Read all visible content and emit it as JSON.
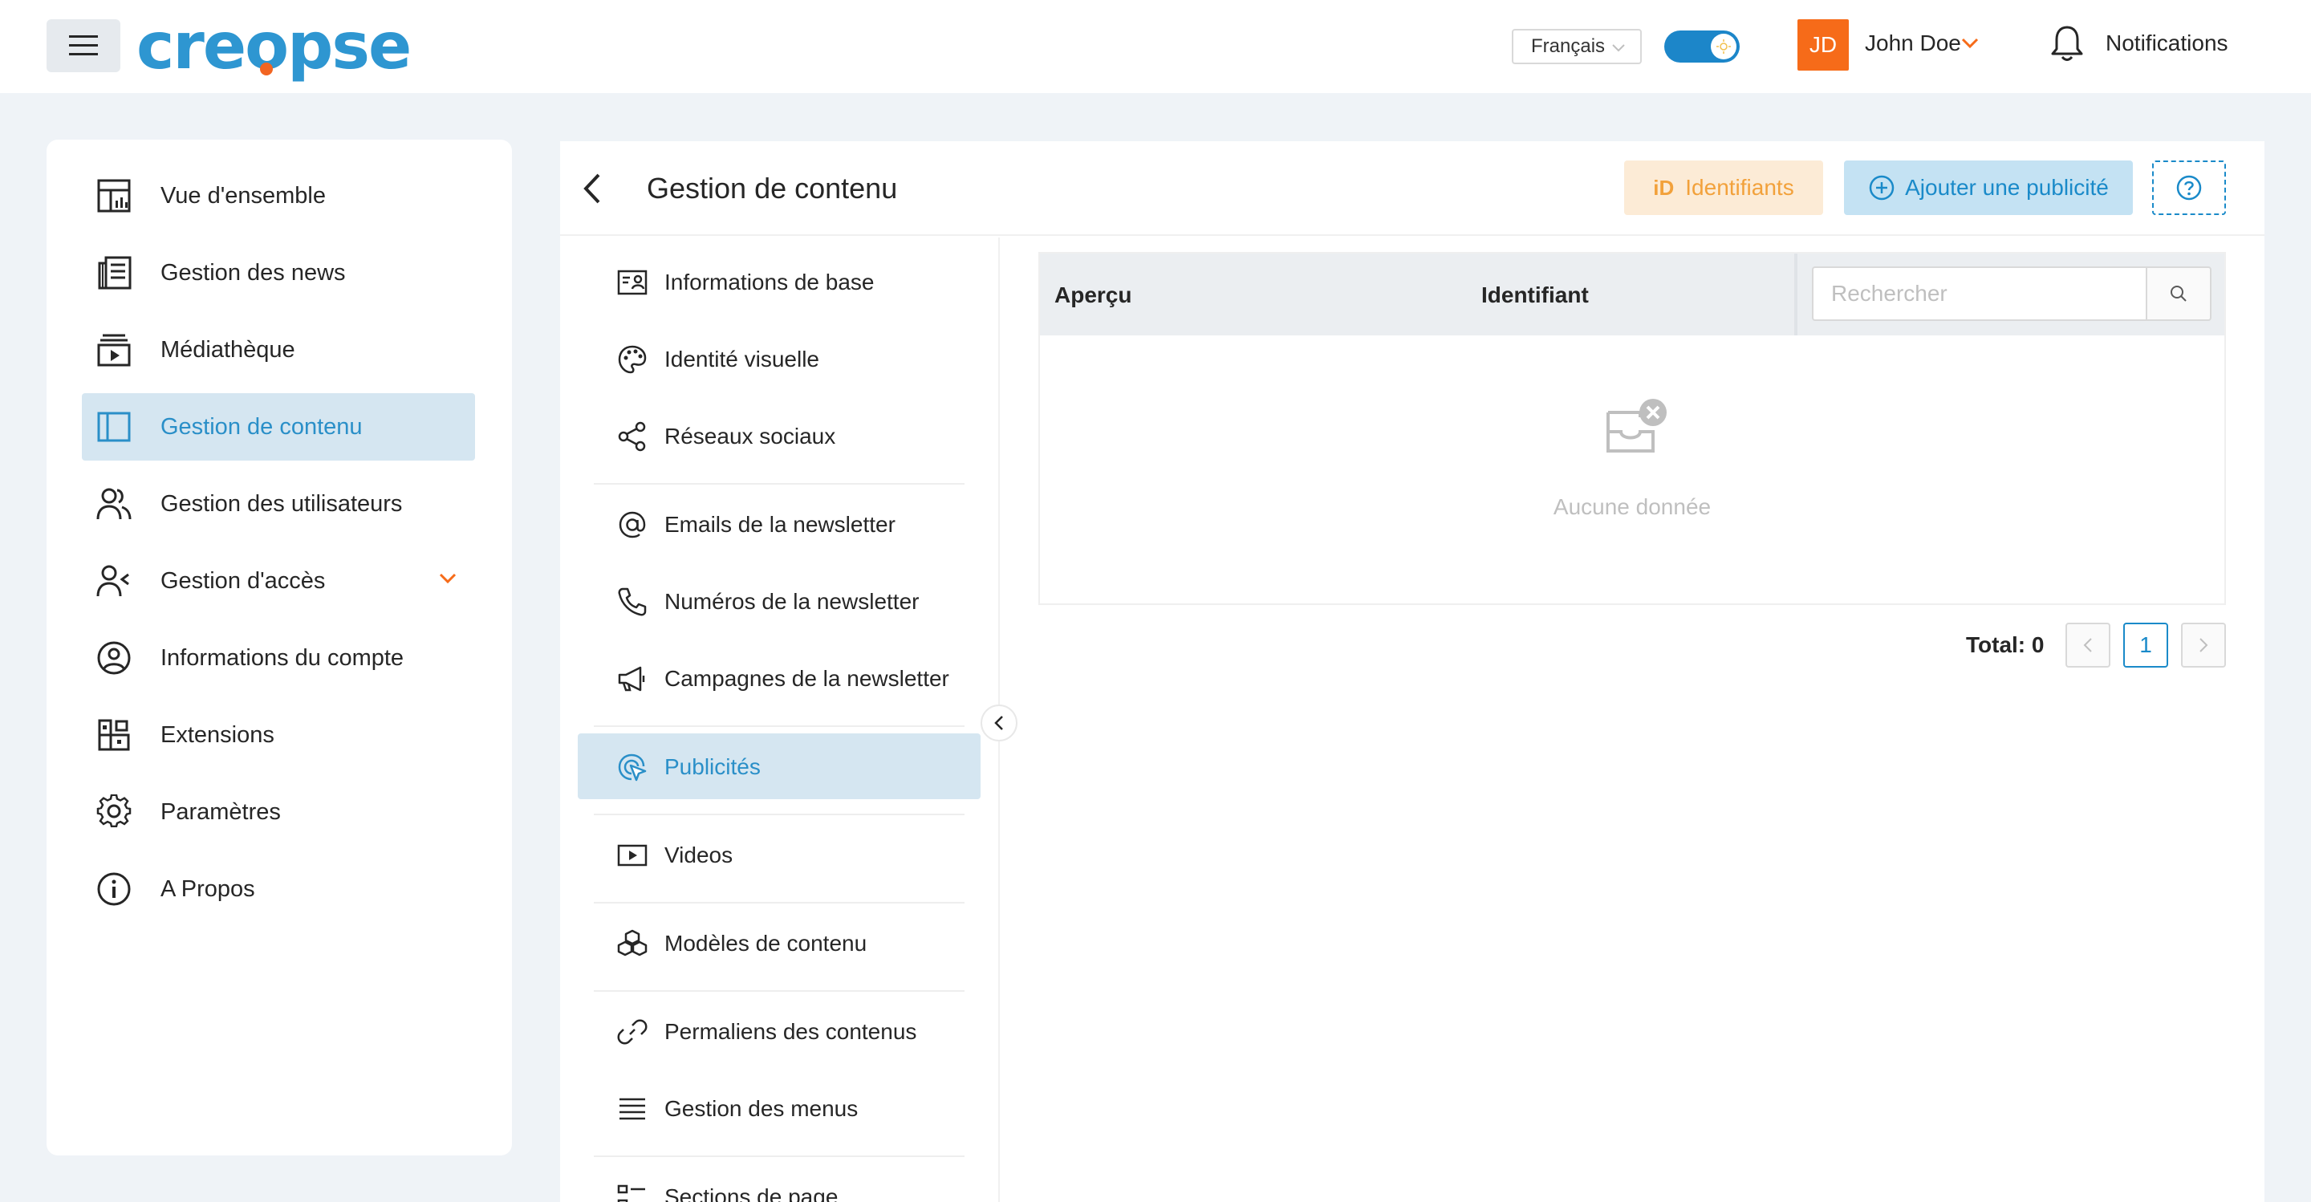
{
  "brand": {
    "logo_text_1": "cre",
    "logo_o": "o",
    "logo_text_2": "pse",
    "accent": "#2e96d1",
    "dot_color": "#f26522"
  },
  "topbar": {
    "language": "Français",
    "theme_toggle_on": true,
    "user": {
      "initials": "JD",
      "name": "John Doe"
    },
    "notifications_label": "Notifications"
  },
  "sidebar": {
    "items": [
      {
        "label": "Vue d'ensemble",
        "icon": "dashboard-icon"
      },
      {
        "label": "Gestion des news",
        "icon": "news-icon"
      },
      {
        "label": "Médiathèque",
        "icon": "media-library-icon"
      },
      {
        "label": "Gestion de contenu",
        "icon": "layout-icon",
        "active": true
      },
      {
        "label": "Gestion des utilisateurs",
        "icon": "users-icon"
      },
      {
        "label": "Gestion d'accès",
        "icon": "user-access-icon",
        "expandable": true
      },
      {
        "label": "Informations du compte",
        "icon": "account-icon"
      },
      {
        "label": "Extensions",
        "icon": "extensions-icon"
      },
      {
        "label": "Paramètres",
        "icon": "settings-icon"
      },
      {
        "label": "A Propos",
        "icon": "info-icon"
      }
    ]
  },
  "main": {
    "title": "Gestion de contenu",
    "buttons": {
      "identifiants": "Identifiants",
      "identifiants_mark": "iD",
      "add_ad": "Ajouter une publicité"
    },
    "submenu": [
      {
        "label": "Informations de base",
        "icon": "id-card-icon"
      },
      {
        "label": "Identité visuelle",
        "icon": "palette-icon"
      },
      {
        "label": "Réseaux sociaux",
        "icon": "share-icon"
      },
      {
        "label": "Emails de la newsletter",
        "icon": "at-icon"
      },
      {
        "label": "Numéros de la newsletter",
        "icon": "phone-icon"
      },
      {
        "label": "Campagnes de la newsletter",
        "icon": "megaphone-icon"
      },
      {
        "label": "Publicités",
        "icon": "ad-cursor-icon",
        "active": true
      },
      {
        "label": "Videos",
        "icon": "video-icon"
      },
      {
        "label": "Modèles de contenu",
        "icon": "blocks-icon"
      },
      {
        "label": "Permaliens des contenus",
        "icon": "link-icon"
      },
      {
        "label": "Gestion des menus",
        "icon": "menu-lines-icon"
      },
      {
        "label": "Sections de page",
        "icon": "sections-icon"
      }
    ],
    "table": {
      "columns": [
        "Aperçu",
        "Identifiant"
      ],
      "search_placeholder": "Rechercher",
      "empty_text": "Aucune donnée",
      "rows": []
    },
    "pagination": {
      "total_label": "Total: 0",
      "current_page": "1"
    }
  }
}
